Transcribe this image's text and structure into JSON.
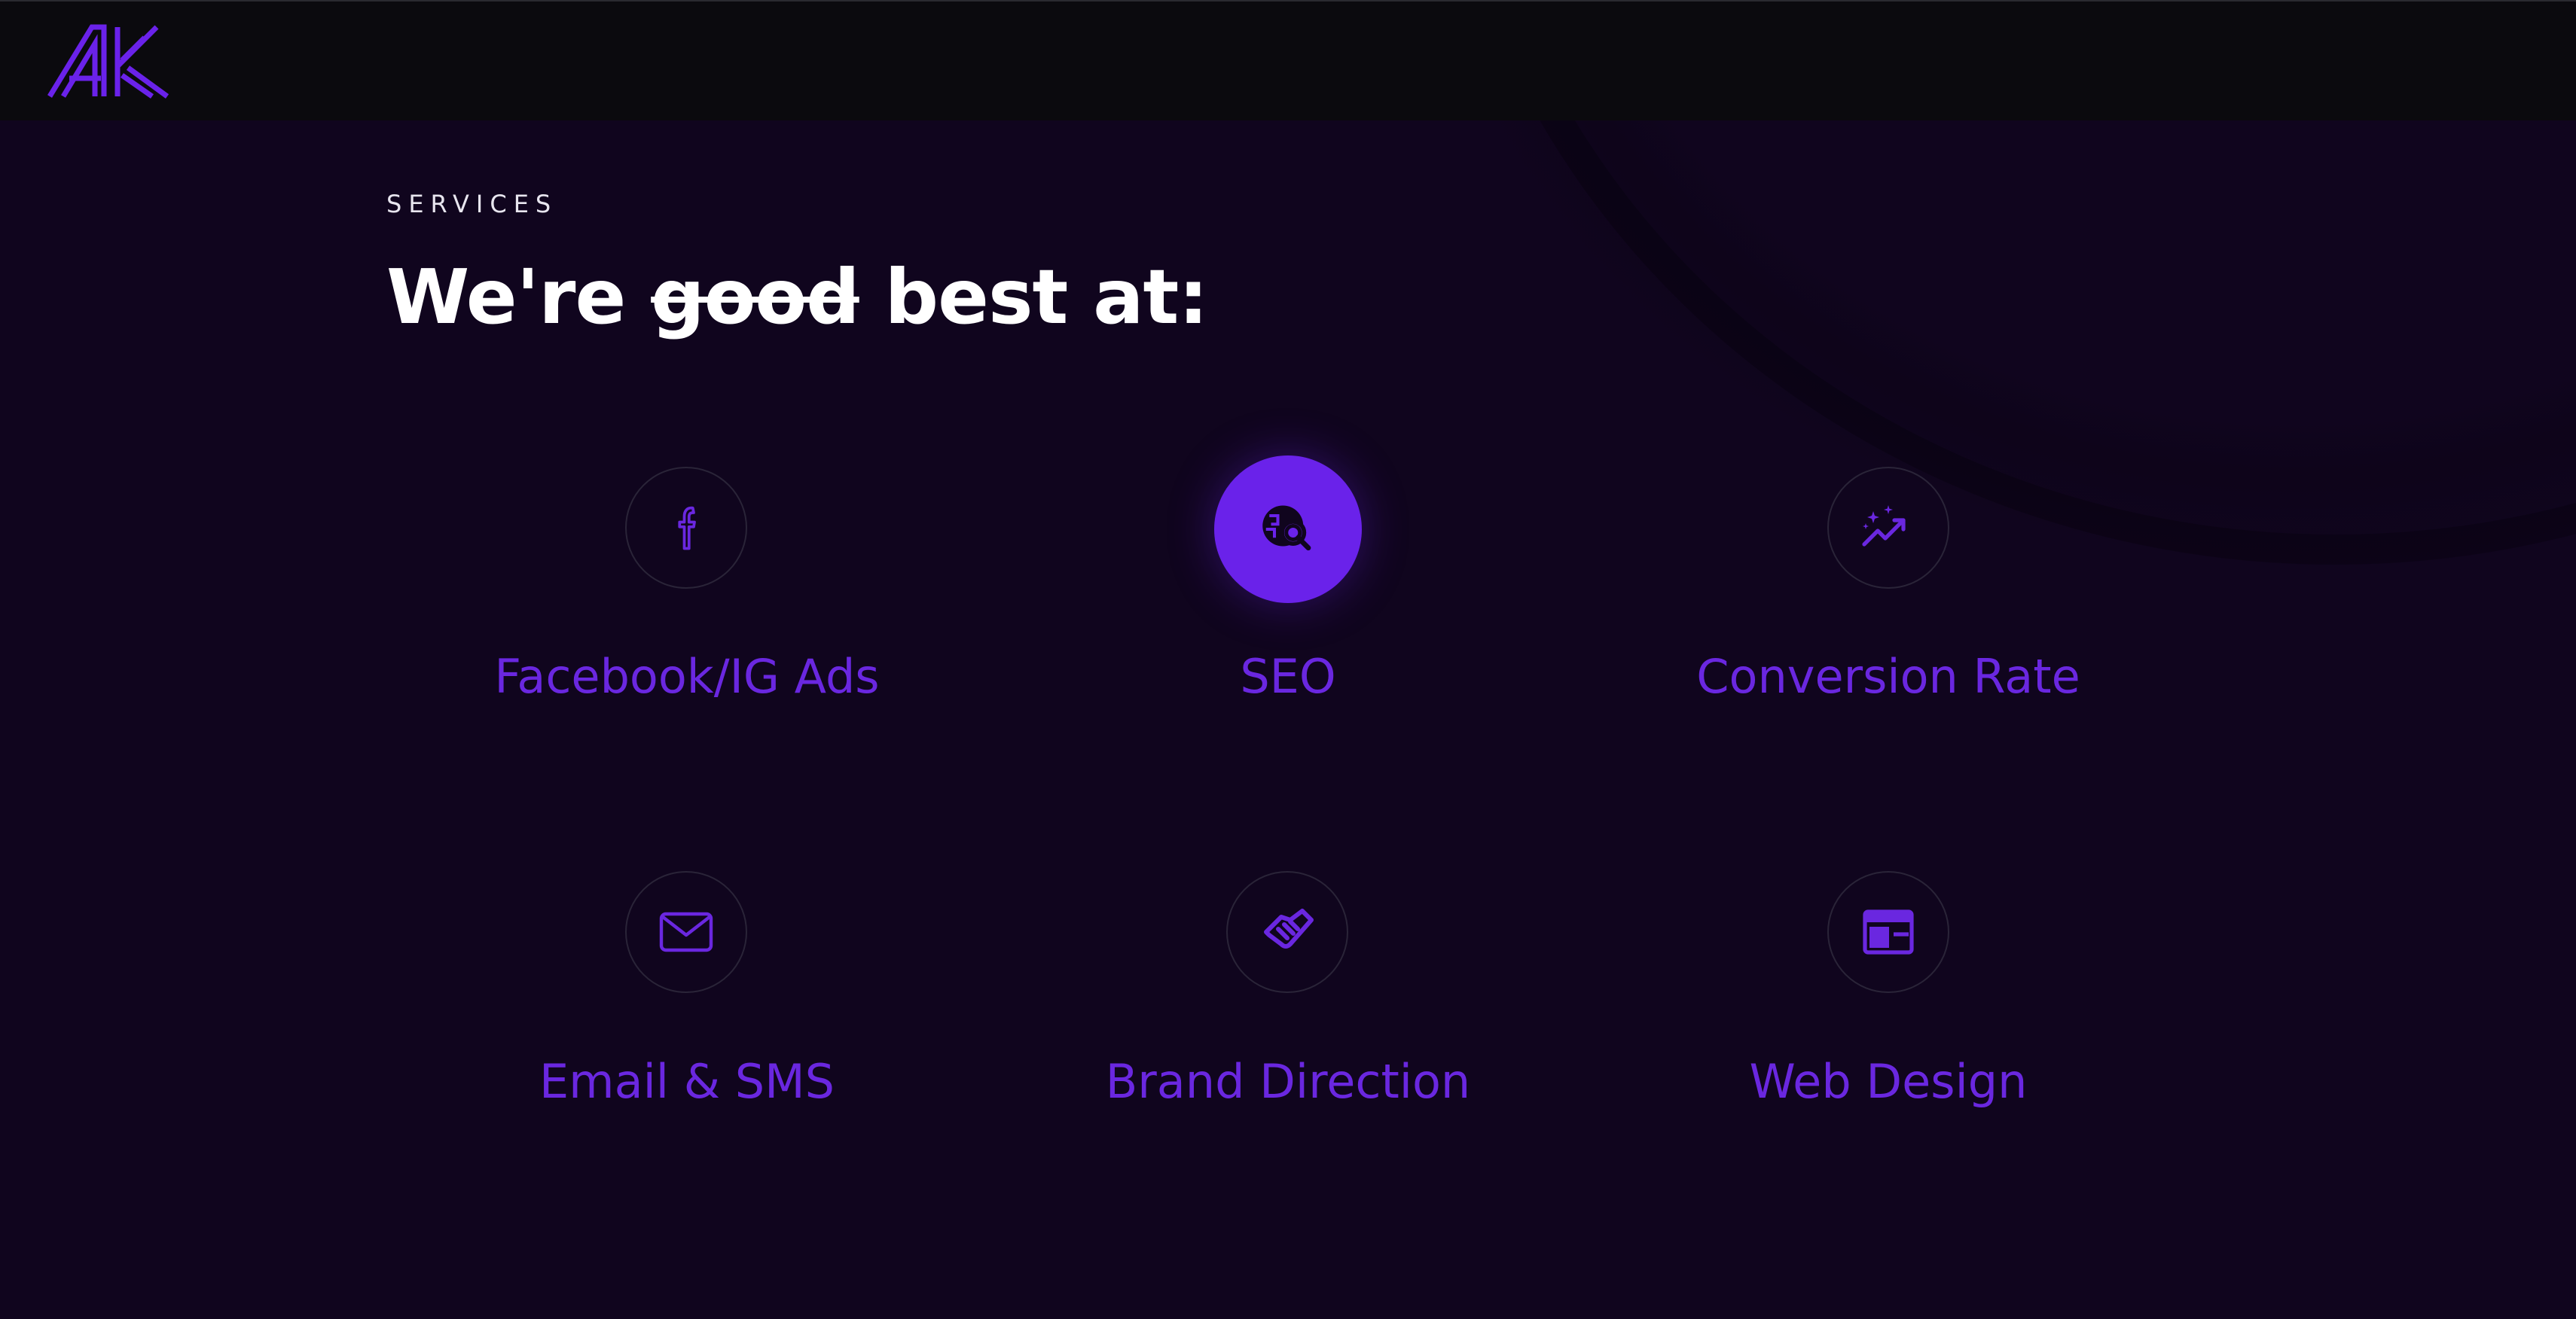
{
  "header": {
    "logo_text": "AK"
  },
  "section": {
    "eyebrow": "SERVICES",
    "headline_before": "We're ",
    "headline_strike": "good",
    "headline_after": " best at:"
  },
  "services": [
    {
      "label": "Facebook/IG Ads",
      "icon": "facebook-icon",
      "active": false
    },
    {
      "label": "SEO",
      "icon": "seo-search-icon",
      "active": true
    },
    {
      "label": "Conversion Rate",
      "icon": "trending-sparkle-icon",
      "active": false
    },
    {
      "label": "Email & SMS",
      "icon": "mail-icon",
      "active": false
    },
    {
      "label": "Brand Direction",
      "icon": "handshake-icon",
      "active": false
    },
    {
      "label": "Web Design",
      "icon": "browser-layout-icon",
      "active": false
    }
  ],
  "colors": {
    "accent": "#6a27e0",
    "active_circle": "#6a22ea",
    "background": "#10051e",
    "header": "#0b0a0e"
  }
}
